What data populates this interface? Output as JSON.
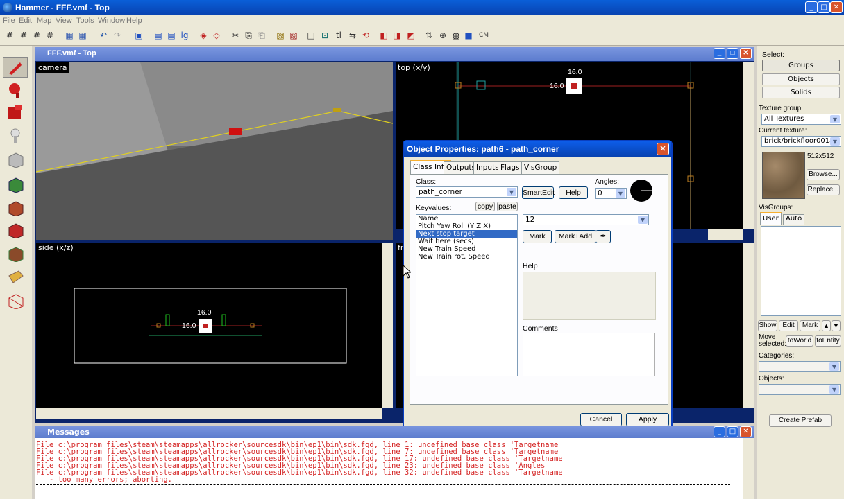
{
  "app": {
    "title": "Hammer - FFF.vmf - Top"
  },
  "menu": [
    "File",
    "Edit",
    "Map",
    "View",
    "Tools",
    "Window",
    "Help"
  ],
  "toolbar": {
    "cm_label": "CM"
  },
  "child": {
    "title": "FFF.vmf - Top",
    "views": {
      "camera": "camera",
      "top": "top (x/y)",
      "side": "side (x/z)",
      "front": "fr"
    },
    "top_size_v": "16.0",
    "top_size_h": "16.0",
    "side_size_v": "16.0",
    "side_size_h": "16.0"
  },
  "dialog": {
    "title": "Object Properties: path6 - path_corner",
    "tabs": [
      "Class Info",
      "Outputs",
      "Inputs",
      "Flags",
      "VisGroup"
    ],
    "class_label": "Class:",
    "class_value": "path_corner",
    "smartedit": "SmartEdit",
    "help_btn": "Help",
    "angles_label": "Angles:",
    "angles_value": "0",
    "keyvalues_label": "Keyvalues:",
    "copy": "copy",
    "paste": "paste",
    "keyvalues": [
      "Name",
      "Pitch Yaw Roll (Y Z X)",
      "Next stop target",
      "Wait here (secs)",
      "New Train Speed",
      "New Train rot. Speed"
    ],
    "selected_index": 2,
    "value": "12",
    "mark": "Mark",
    "mark_add": "Mark+Add",
    "help_label": "Help",
    "comments_label": "Comments",
    "cancel": "Cancel",
    "apply": "Apply"
  },
  "right": {
    "select_label": "Select:",
    "groups": "Groups",
    "objects": "Objects",
    "solids": "Solids",
    "texture_group_label": "Texture group:",
    "texture_group": "All Textures",
    "current_texture_label": "Current texture:",
    "current_texture": "brick/brickfloor001a",
    "texture_size": "512x512",
    "browse": "Browse...",
    "replace": "Replace...",
    "visgroups_label": "VisGroups:",
    "user_tab": "User",
    "auto_tab": "Auto",
    "show": "Show",
    "edit": "Edit",
    "mark": "Mark",
    "move_selected": "Move selected:",
    "to_world": "toWorld",
    "to_entity": "toEntity",
    "categories_label": "Categories:",
    "objects_label": "Objects:",
    "create_prefab": "Create Prefab"
  },
  "messages": {
    "title": "Messages",
    "lines": [
      "File c:\\program files\\steam\\steamapps\\allrocker\\sourcesdk\\bin\\ep1\\bin\\sdk.fgd, line 1: undefined base class 'Targetname",
      "File c:\\program files\\steam\\steamapps\\allrocker\\sourcesdk\\bin\\ep1\\bin\\sdk.fgd, line 7: undefined base class 'Targetname",
      "File c:\\program files\\steam\\steamapps\\allrocker\\sourcesdk\\bin\\ep1\\bin\\sdk.fgd, line 17: undefined base class 'Targetname",
      "File c:\\program files\\steam\\steamapps\\allrocker\\sourcesdk\\bin\\ep1\\bin\\sdk.fgd, line 23: undefined base class 'Angles",
      "File c:\\program files\\steam\\steamapps\\allrocker\\sourcesdk\\bin\\ep1\\bin\\sdk.fgd, line 32: undefined base class 'Targetname",
      "   - too many errors; aborting."
    ]
  }
}
